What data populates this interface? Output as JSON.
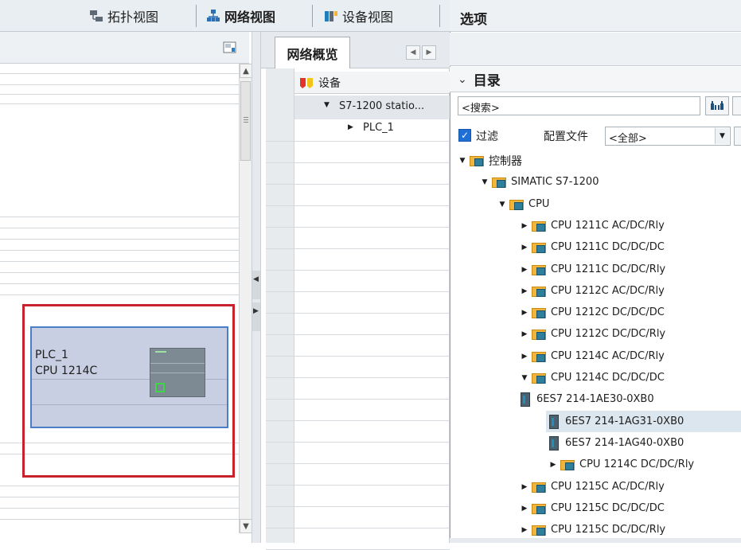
{
  "view_tabs": [
    {
      "label": "拓扑视图",
      "icon": "topology-view-icon"
    },
    {
      "label": "网络视图",
      "icon": "network-view-icon"
    },
    {
      "label": "设备视图",
      "icon": "device-view-icon"
    }
  ],
  "canvas": {
    "plc_name": "PLC_1",
    "plc_type": "CPU 1214C"
  },
  "overview": {
    "tab_label": "网络概览",
    "column_header": "设备",
    "rows": [
      {
        "label": "S7-1200 statio..."
      },
      {
        "label": "PLC_1"
      }
    ]
  },
  "right": {
    "title": "选项",
    "catalog_title": "目录",
    "search_value": "<搜索>",
    "filter_label": "过滤",
    "profile_label": "配置文件",
    "profile_value": "<全部>",
    "tree": [
      {
        "label": "控制器",
        "type": "folder",
        "expanded": true
      },
      {
        "label": "SIMATIC S7-1200",
        "type": "folder",
        "expanded": true
      },
      {
        "label": "CPU",
        "type": "folder",
        "expanded": true
      },
      {
        "label": "CPU 1211C AC/DC/Rly",
        "type": "folder",
        "expanded": false
      },
      {
        "label": "CPU 1211C DC/DC/DC",
        "type": "folder",
        "expanded": false
      },
      {
        "label": "CPU 1211C DC/DC/Rly",
        "type": "folder",
        "expanded": false
      },
      {
        "label": "CPU 1212C AC/DC/Rly",
        "type": "folder",
        "expanded": false
      },
      {
        "label": "CPU 1212C DC/DC/DC",
        "type": "folder",
        "expanded": false
      },
      {
        "label": "CPU 1212C DC/DC/Rly",
        "type": "folder",
        "expanded": false
      },
      {
        "label": "CPU 1214C AC/DC/Rly",
        "type": "folder",
        "expanded": false
      },
      {
        "label": "CPU 1214C DC/DC/DC",
        "type": "folder",
        "expanded": true
      },
      {
        "label": "6ES7 214-1AE30-0XB0",
        "type": "module"
      },
      {
        "label": "6ES7 214-1AG31-0XB0",
        "type": "module",
        "selected": true
      },
      {
        "label": "6ES7 214-1AG40-0XB0",
        "type": "module"
      },
      {
        "label": "CPU 1214C DC/DC/Rly",
        "type": "folder",
        "expanded": false
      },
      {
        "label": "CPU 1215C AC/DC/Rly",
        "type": "folder",
        "expanded": false
      },
      {
        "label": "CPU 1215C DC/DC/DC",
        "type": "folder",
        "expanded": false
      },
      {
        "label": "CPU 1215C DC/DC/Rly",
        "type": "folder",
        "expanded": false
      }
    ]
  },
  "colors": {
    "highlight_outline": "#c8232c",
    "plc_box_border": "#4a7fc8",
    "selection_background": "#dce6ee"
  }
}
